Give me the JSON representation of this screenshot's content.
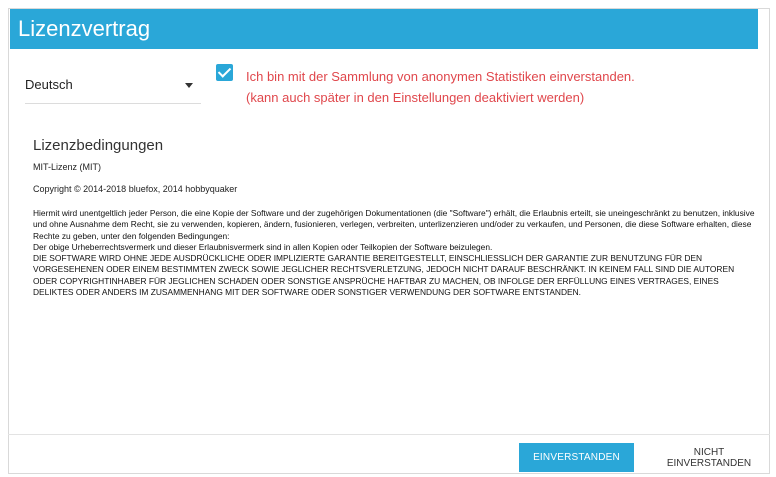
{
  "dialog": {
    "title": "Lizenzvertrag"
  },
  "language": {
    "selected": "Deutsch",
    "icon": "chevron-down-icon"
  },
  "statistics": {
    "checked": true,
    "line1": "Ich bin mit der Sammlung von anonymen Statistiken einverstanden.",
    "line2": "(kann auch später in den Einstellungen deaktiviert werden)",
    "color": "#e0474c"
  },
  "license": {
    "heading": "Lizenzbedingungen",
    "type": "MIT-Lizenz (MIT)",
    "copyright": "Copyright © 2014-2018 bluefox, 2014 hobbyquaker",
    "paragraph1": "Hiermit wird unentgeltlich jeder Person, die eine Kopie der Software und der zugehörigen Dokumentationen (die \"Software\") erhält, die Erlaubnis erteilt, sie uneingeschränkt zu benutzen, inklusive und ohne Ausnahme dem Recht, sie zu verwenden, kopieren, ändern, fusionieren, verlegen, verbreiten, unterlizenzieren und/oder zu verkaufen, und Personen, die diese Software erhalten, diese Rechte zu geben, unter den folgenden Bedingungen:",
    "paragraph2": "Der obige Urheberrechtsvermerk und dieser Erlaubnisvermerk sind in allen Kopien oder Teilkopien der Software beizulegen.",
    "paragraph3": "DIE SOFTWARE WIRD OHNE JEDE AUSDRÜCKLICHE ODER IMPLIZIERTE GARANTIE BEREITGESTELLT, EINSCHLIESSLICH DER GARANTIE ZUR BENUTZUNG FÜR DEN VORGESEHENEN ODER EINEM BESTIMMTEN ZWECK SOWIE JEGLICHER RECHTSVERLETZUNG, JEDOCH NICHT DARAUF BESCHRÄNKT. IN KEINEM FALL SIND DIE AUTOREN ODER COPYRIGHTINHABER FÜR JEGLICHEN SCHADEN ODER SONSTIGE ANSPRÜCHE HAFTBAR ZU MACHEN, OB INFOLGE DER ERFÜLLUNG EINES VERTRAGES, EINES DELIKTES ODER ANDERS IM ZUSAMMENHANG MIT DER SOFTWARE ODER SONSTIGER VERWENDUNG DER SOFTWARE ENTSTANDEN."
  },
  "actions": {
    "agree": "EINVERSTANDEN",
    "decline": "NICHT EINVERSTANDEN"
  },
  "colors": {
    "accent": "#2aa7d8"
  }
}
